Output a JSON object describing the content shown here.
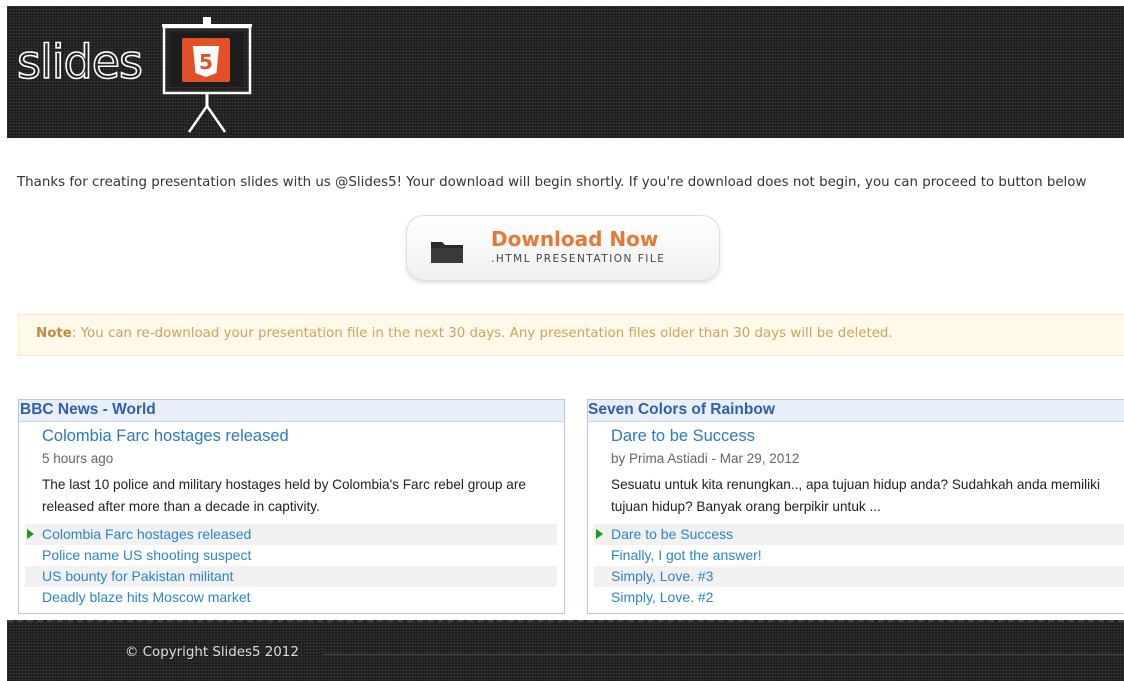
{
  "header": {
    "logo_text": "slides",
    "logo_badge": "5"
  },
  "message": {
    "thanks": "Thanks for creating presentation slides with us @Slides5! Your download will begin shortly. If you're download does not begin, you can proceed to button below"
  },
  "download": {
    "title": "Download Now",
    "subtitle": ".HTML PRESENTATION FILE",
    "icon": "folder-icon"
  },
  "note": {
    "label": "Note",
    "text": ": You can re-download your presentation file in the next 30 days. Any presentation files older than 30 days will be deleted."
  },
  "widgets": [
    {
      "heading": "BBC News - World",
      "story_title": "Colombia Farc hostages released",
      "story_meta": "5 hours ago",
      "story_desc": "The last 10 police and military hostages held by Colombia's Farc rebel group are released after more than a decade in captivity.",
      "items": [
        {
          "label": "Colombia Farc hostages released"
        },
        {
          "label": "Police name US shooting suspect"
        },
        {
          "label": "US bounty for Pakistan militant"
        },
        {
          "label": "Deadly blaze hits Moscow market"
        }
      ]
    },
    {
      "heading": "Seven Colors of Rainbow",
      "story_title": "Dare to be Success",
      "story_meta": "by Prima Astiadi - Mar 29, 2012",
      "story_desc": "Sesuatu untuk kita renungkan.., apa tujuan hidup anda? Sudahkah anda memiliki tujuan hidup? Banyak orang berpikir untuk ...",
      "items": [
        {
          "label": "Dare to be Success"
        },
        {
          "label": "Finally, I got the answer!"
        },
        {
          "label": "Simply, Love. #3"
        },
        {
          "label": "Simply, Love. #2"
        }
      ]
    }
  ],
  "footer": {
    "copyright": "© Copyright Slides5 2012"
  },
  "colors": {
    "header_bg": "#1d1d1d",
    "accent_orange": "#e57a36",
    "link_blue": "#2a79c4",
    "note_bg": "#fff9ea",
    "widget_border": "#b6c9e3",
    "html5_badge": "#e34f26"
  }
}
